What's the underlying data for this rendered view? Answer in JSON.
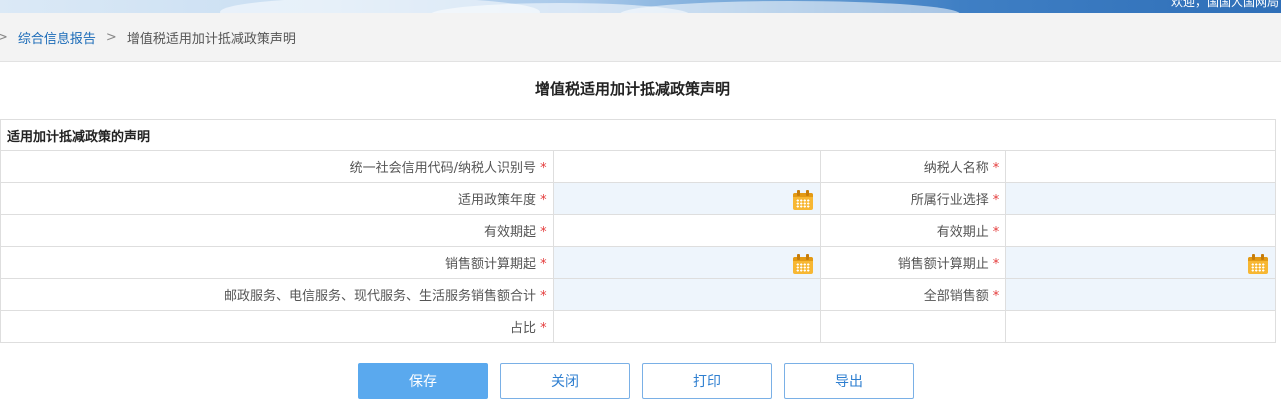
{
  "header": {
    "user_text": "欢迎，国国人国网局"
  },
  "breadcrumb": {
    "separator": ">",
    "link": "综合信息报告",
    "current": "增值税适用加计抵减政策声明"
  },
  "page_title": "增值税适用加计抵减政策声明",
  "form": {
    "section_title": "适用加计抵减政策的声明",
    "required_mark": "*",
    "rows": [
      {
        "left_label": "统一社会信用代码/纳税人识别号",
        "left_value": "",
        "right_label": "纳税人名称",
        "right_value": ""
      },
      {
        "left_label": "适用政策年度",
        "left_value": "",
        "right_label": "所属行业选择",
        "right_value": ""
      },
      {
        "left_label": "有效期起",
        "left_value": "",
        "right_label": "有效期止",
        "right_value": ""
      },
      {
        "left_label": "销售额计算期起",
        "left_value": "",
        "right_label": "销售额计算期止",
        "right_value": ""
      },
      {
        "left_label": "邮政服务、电信服务、现代服务、生活服务销售额合计",
        "left_value": "",
        "right_label": "全部销售额",
        "right_value": ""
      },
      {
        "left_label": "占比",
        "left_value": "",
        "right_label": "",
        "right_value": ""
      }
    ]
  },
  "buttons": {
    "save": "保存",
    "close": "关闭",
    "print": "打印",
    "export": "导出"
  },
  "icons": {
    "date_picker": "calendar-icon"
  },
  "colors": {
    "primary": "#5aa9ee",
    "link": "#1b6bb8",
    "required": "#e43b3b",
    "calendar": "#f7b733"
  }
}
